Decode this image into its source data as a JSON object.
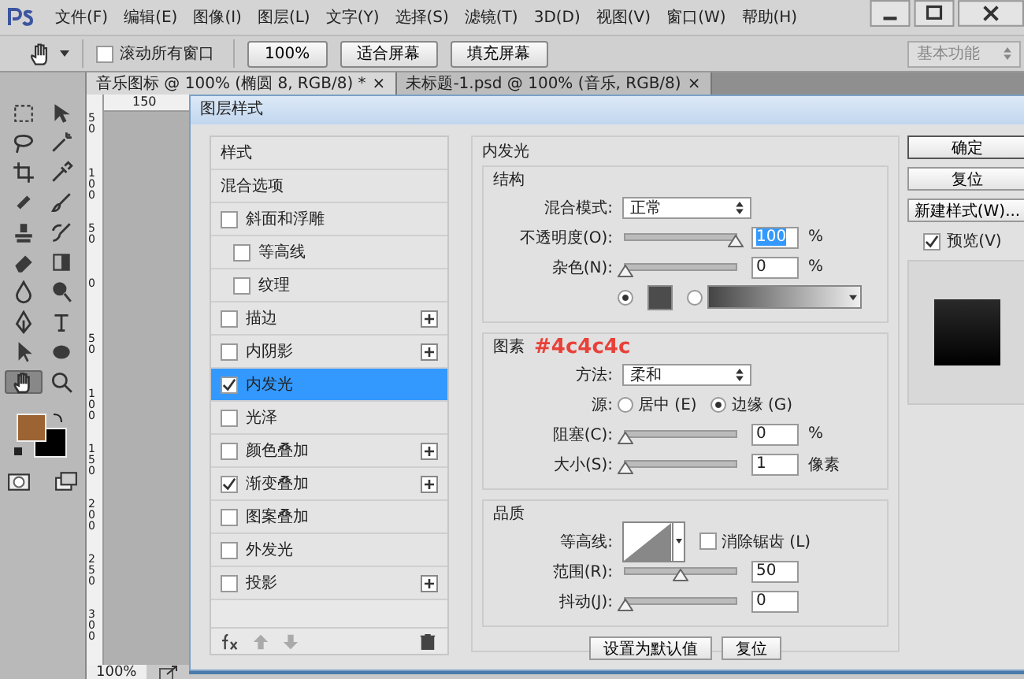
{
  "menu_bar": {
    "items": [
      "文件(F)",
      "编辑(E)",
      "图像(I)",
      "图层(L)",
      "文字(Y)",
      "选择(S)",
      "滤镜(T)",
      "3D(D)",
      "视图(V)",
      "窗口(W)",
      "帮助(H)"
    ]
  },
  "options_bar": {
    "scroll_all": {
      "label": "滚动所有窗口",
      "checked": false
    },
    "buttons": [
      "100%",
      "适合屏幕",
      "填充屏幕"
    ],
    "workspace": "基本功能"
  },
  "tools": [
    {
      "selected": false
    },
    {
      "selected": false
    },
    {
      "selected": false
    },
    {
      "selected": false
    },
    {
      "selected": false
    },
    {
      "selected": false
    },
    {
      "selected": false
    },
    {
      "selected": false
    },
    {
      "selected": false
    },
    {
      "selected": false
    },
    {
      "selected": false
    },
    {
      "selected": false
    },
    {
      "selected": false
    },
    {
      "selected": false
    },
    {
      "selected": false
    },
    {
      "selected": false
    },
    {
      "selected": false
    },
    {
      "selected": false
    },
    {
      "selected": true
    },
    {
      "selected": false
    }
  ],
  "document_tabs": [
    {
      "title": "音乐图标 @ 100% (椭圆 8, RGB/8) *",
      "close": "×",
      "selected": true
    },
    {
      "title": "未标题-1.psd @ 100% (音乐, RGB/8)",
      "close": "×",
      "selected": false
    }
  ],
  "top_ruler": "150",
  "left_ruler": [
    "50",
    "100",
    "50",
    "0",
    "50",
    "100",
    "150",
    "200",
    "250",
    "300"
  ],
  "zoom_level": "100%",
  "dialog": {
    "title": "图层样式",
    "effects": [
      {
        "kind": "header",
        "label": "样式",
        "selected": false
      },
      {
        "kind": "header",
        "label": "混合选项",
        "selected": false
      },
      {
        "kind": "effect",
        "label": "斜面和浮雕",
        "checked": false,
        "add": false,
        "selected": false,
        "children": [
          {
            "kind": "effect",
            "label": "等高线",
            "checked": false,
            "add": false,
            "selected": false
          },
          {
            "kind": "effect",
            "label": "纹理",
            "checked": false,
            "add": false,
            "selected": false
          }
        ]
      },
      {
        "kind": "effect",
        "label": "描边",
        "checked": false,
        "add": true,
        "selected": false
      },
      {
        "kind": "effect",
        "label": "内阴影",
        "checked": false,
        "add": true,
        "selected": false
      },
      {
        "kind": "effect",
        "label": "内发光",
        "checked": true,
        "add": false,
        "selected": true
      },
      {
        "kind": "effect",
        "label": "光泽",
        "checked": false,
        "add": false,
        "selected": false
      },
      {
        "kind": "effect",
        "label": "颜色叠加",
        "checked": false,
        "add": true,
        "selected": false
      },
      {
        "kind": "effect",
        "label": "渐变叠加",
        "checked": true,
        "add": true,
        "selected": false
      },
      {
        "kind": "effect",
        "label": "图案叠加",
        "checked": false,
        "add": false,
        "selected": false
      },
      {
        "kind": "effect",
        "label": "外发光",
        "checked": false,
        "add": false,
        "selected": false
      },
      {
        "kind": "effect",
        "label": "投影",
        "checked": false,
        "add": true,
        "selected": false
      }
    ],
    "list_actions": [
      {
        "kind": "fx",
        "disabled": false
      },
      {
        "kind": "up",
        "disabled": true
      },
      {
        "kind": "down",
        "disabled": true
      },
      {
        "kind": "delete",
        "disabled": false
      }
    ],
    "panel_title": "内发光",
    "sections": [
      {
        "title": "结构",
        "rows": [
          {
            "kind": "select",
            "label": "混合模式:",
            "value": "正常"
          },
          {
            "kind": "slider",
            "label": "不透明度(O):",
            "level": 1,
            "value": "100",
            "unit": "%",
            "highlighted": true
          },
          {
            "kind": "slider",
            "label": "杂色(N):",
            "level": 0,
            "value": "0",
            "unit": "%",
            "highlighted": false
          },
          {
            "kind": "fill",
            "options": [
              {
                "kind": "color",
                "selected": true,
                "color": "#4c4c4c"
              },
              {
                "kind": "gradient",
                "selected": false
              }
            ]
          }
        ]
      },
      {
        "title": "图素",
        "annotation": "#4c4c4c",
        "rows": [
          {
            "kind": "select",
            "label": "方法:",
            "value": "柔和"
          },
          {
            "kind": "radios",
            "label": "源:",
            "options": [
              {
                "label": "居中 (E)",
                "selected": false
              },
              {
                "label": "边缘 (G)",
                "selected": true
              }
            ]
          },
          {
            "kind": "slider",
            "label": "阻塞(C):",
            "level": 0,
            "value": "0",
            "unit": "%",
            "highlighted": false
          },
          {
            "kind": "slider",
            "label": "大小(S):",
            "level": 0,
            "value": "1",
            "unit": "像素",
            "highlighted": false
          }
        ]
      },
      {
        "title": "品质",
        "rows": [
          {
            "kind": "contour",
            "label": "等高线:",
            "checkbox": {
              "label": "消除锯齿 (L)",
              "checked": false
            }
          },
          {
            "kind": "slider",
            "label": "范围(R):",
            "level": 0.5,
            "value": "50",
            "highlighted": false
          },
          {
            "kind": "slider",
            "label": "抖动(J):",
            "level": 0,
            "value": "0",
            "highlighted": false
          }
        ]
      }
    ],
    "panel_buttons": [
      "设置为默认值",
      "复位"
    ],
    "side_buttons": [
      "确定",
      "复位",
      "新建样式(W)..."
    ],
    "preview": {
      "label": "预览(V)",
      "checked": true
    }
  }
}
